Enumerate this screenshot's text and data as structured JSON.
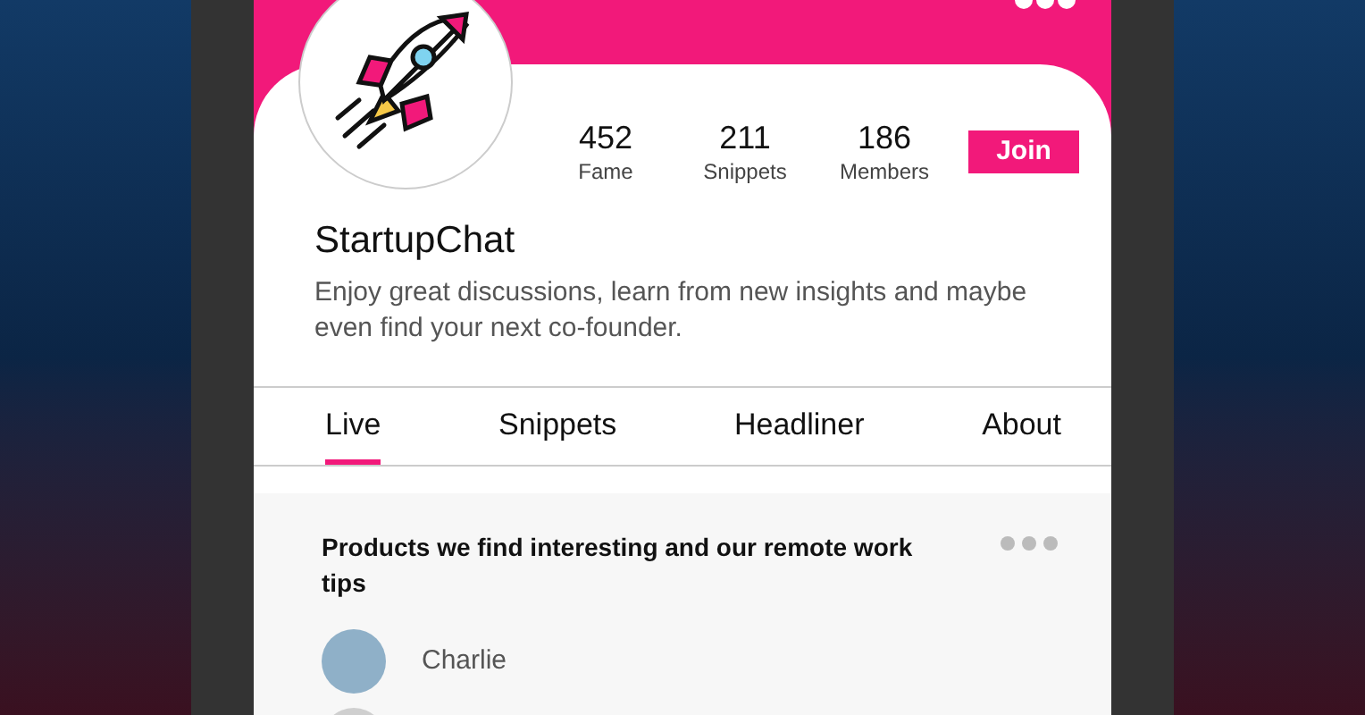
{
  "group": {
    "name": "StartupChat",
    "description": "Enjoy great discussions, learn from new insights and maybe even find your next co-founder.",
    "join_button": "Join"
  },
  "stats": [
    {
      "value": "452",
      "label": "Fame"
    },
    {
      "value": "211",
      "label": "Snippets"
    },
    {
      "value": "186",
      "label": "Members"
    }
  ],
  "tabs": [
    {
      "label": "Live",
      "selected": true
    },
    {
      "label": "Snippets",
      "selected": false
    },
    {
      "label": "Headliner",
      "selected": false
    },
    {
      "label": "About",
      "selected": false
    }
  ],
  "post": {
    "title": "Products we find interesting and our remote work tips",
    "author": "Charlie"
  }
}
